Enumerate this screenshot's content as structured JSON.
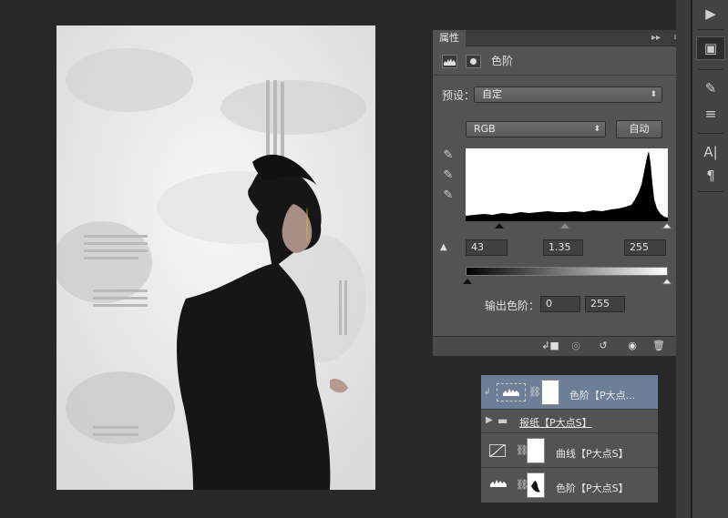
{
  "panel": {
    "tab": "属性",
    "expand": "▸▸",
    "menu": "≡",
    "adjustment_title": "色阶",
    "preset_label": "预设：",
    "preset_value": "自定",
    "channel_value": "RGB",
    "auto_label": "自动",
    "input_levels": {
      "black": "43",
      "gamma": "1.35",
      "white": "255"
    },
    "output_label": "输出色阶：",
    "output_levels": {
      "black": "0",
      "white": "255"
    }
  },
  "layers": [
    {
      "name": "色阶【P大点...",
      "type": "levels",
      "selected": true
    },
    {
      "name": "报纸【P大点S】",
      "type": "group",
      "selected": false
    },
    {
      "name": "曲线【P大点S】",
      "type": "curves",
      "selected": false
    },
    {
      "name": "色阶【P大点S】",
      "type": "levels",
      "selected": false
    }
  ],
  "icons": {
    "play": "play-icon",
    "properties": "properties-icon",
    "brush": "brush-icon",
    "sliders": "sliders-icon",
    "character": "character-icon",
    "paragraph": "paragraph-icon"
  },
  "colors": {
    "panel_bg": "#535353",
    "selected_layer": "#6d7e96",
    "app_bg": "#282828"
  }
}
